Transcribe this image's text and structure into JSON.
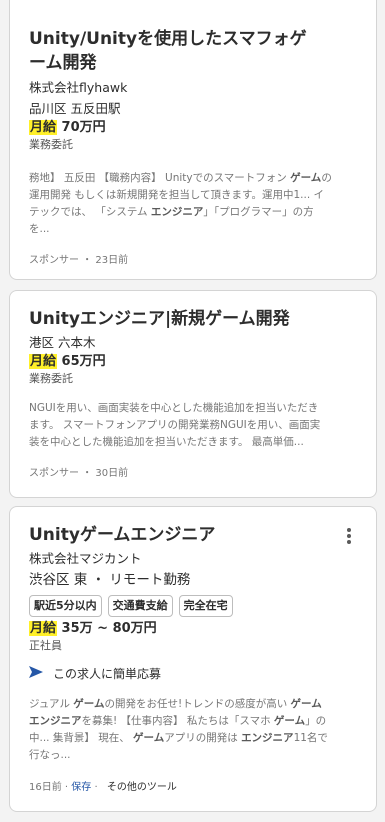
{
  "jobs": [
    {
      "title_line1": "Unity/Unityを使用したスマフォゲ",
      "title_line2": "ーム開発",
      "company": "株式会社flyhawk",
      "location": "品川区 五反田駅",
      "salary_label": "月給",
      "salary_value": "70万円",
      "employment_type": "業務委託",
      "snippet_lines": [
        [
          "務地】 五反田 【職務内容】 Unityでのスマートフォン ",
          "ゲーム",
          "の"
        ],
        [
          "運用開発 もしくは新規開発を担当して頂きます。運用中1... イ"
        ],
        [
          "テックでは、 「システム ",
          "エンジニア",
          "」「プログラマー」の方"
        ],
        [
          "を..."
        ]
      ],
      "meta": "スポンサー ・ 23日前"
    },
    {
      "title": "Unityエンジニア|新規ゲーム開発",
      "location": "港区 六本木",
      "salary_label": "月給",
      "salary_value": "65万円",
      "employment_type": "業務委託",
      "snippet_lines": [
        "NGUIを用い、画面実装を中心とした機能追加を担当いただき",
        "ます。 スマートフォンアプリの開発業務NGUIを用い、画面実",
        "装を中心とした機能追加を担当いただきます。 最高単価..."
      ],
      "meta": "スポンサー ・ 30日前"
    },
    {
      "title": "Unityゲームエンジニア",
      "company": "株式会社マジカント",
      "location": "渋谷区 東 ・ リモート勤務",
      "tags": [
        "駅近5分以内",
        "交通費支給",
        "完全在宅"
      ],
      "salary_label": "月給",
      "salary_value": "35万 ~ 80万円",
      "employment_type": "正社員",
      "easy_apply": "この求人に簡単応募",
      "snippet_lines": [
        [
          "ジュアル ",
          "ゲーム",
          "の開発をお任せ!トレンドの感度が高い ",
          "ゲーム"
        ],
        [
          "",
          "エンジニア",
          "を募集! 【仕事内容】 私たちは「スマホ ",
          "ゲーム",
          "」の"
        ],
        [
          "中... 集背景】 現在、 ",
          "ゲーム",
          "アプリの開発は ",
          "エンジニア",
          "11名で"
        ],
        [
          "行なっ..."
        ]
      ],
      "meta_date": "16日前",
      "meta_save": "保存",
      "meta_tools": "その他のツール",
      "meta_sep": "·"
    }
  ],
  "icons": {
    "easy_apply": "paper-plane-icon",
    "menu": "more-vertical-icon"
  },
  "colors": {
    "highlight": "#fff02a",
    "link": "#2557a7",
    "easy_apply_icon": "#2557a7"
  }
}
